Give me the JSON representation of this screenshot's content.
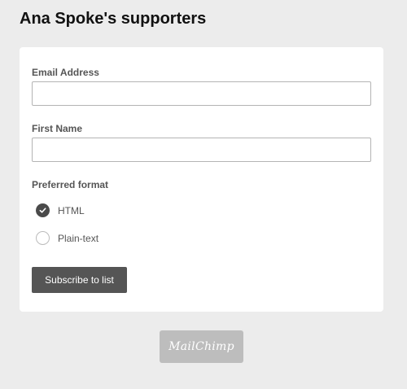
{
  "page": {
    "title": "Ana Spoke's supporters"
  },
  "form": {
    "email": {
      "label": "Email Address",
      "value": "",
      "placeholder": ""
    },
    "first_name": {
      "label": "First Name",
      "value": "",
      "placeholder": ""
    },
    "format": {
      "label": "Preferred format",
      "options": [
        {
          "label": "HTML",
          "selected": true
        },
        {
          "label": "Plain-text",
          "selected": false
        }
      ]
    },
    "submit_label": "Subscribe to list"
  },
  "footer": {
    "badge_text": "MailChimp"
  },
  "colors": {
    "background": "#ececec",
    "card": "#ffffff",
    "button": "#555555",
    "badge": "#bdbdbd"
  }
}
